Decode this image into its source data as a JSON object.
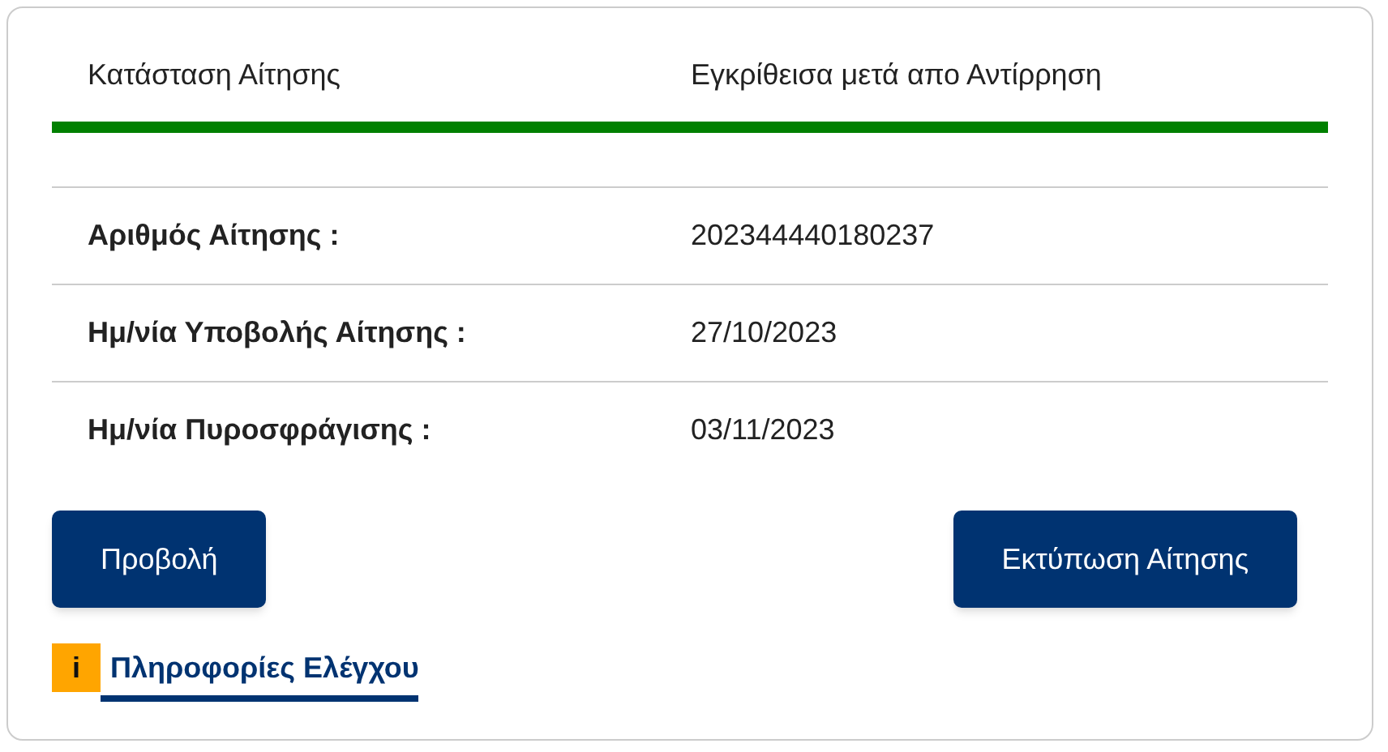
{
  "status": {
    "label": "Κατάσταση Αίτησης",
    "value": "Εγκρίθεισα μετά απο Αντίρρηση",
    "color": "#008000"
  },
  "details": [
    {
      "label": "Αριθμός Αίτησης :",
      "value": "202344440180237"
    },
    {
      "label": "Ημ/νία Υποβολής Αίτησης :",
      "value": "27/10/2023"
    },
    {
      "label": "Ημ/νία Πυροσφράγισης :",
      "value": "03/11/2023"
    }
  ],
  "buttons": [
    "Προβολή",
    "Εκτύπωση Αίτησης"
  ],
  "info_link": {
    "icon": "i",
    "label": "Πληροφορίες Ελέγχου"
  }
}
